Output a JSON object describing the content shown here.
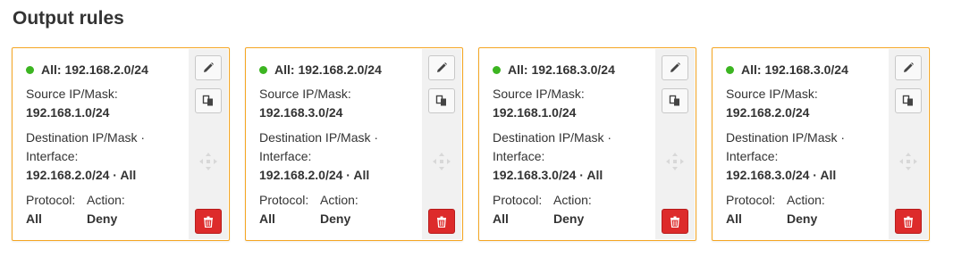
{
  "page": {
    "title": "Output rules"
  },
  "labels": {
    "source": "Source IP/Mask:",
    "destination_line1": "Destination IP/Mask ·",
    "destination_line2": "Interface:",
    "protocol": "Protocol:",
    "action": "Action:"
  },
  "colors": {
    "card_border": "#f5a623",
    "status_active": "#3cb521",
    "delete_button": "#dd2b2b"
  },
  "icons": [
    "pencil-icon",
    "copy-icon",
    "drag-move-icon",
    "trash-icon"
  ],
  "rules": [
    {
      "title": "All: 192.168.2.0/24",
      "source": "192.168.1.0/24",
      "destination": "192.168.2.0/24 · All",
      "protocol": "All",
      "action": "Deny"
    },
    {
      "title": "All: 192.168.2.0/24",
      "source": "192.168.3.0/24",
      "destination": "192.168.2.0/24 · All",
      "protocol": "All",
      "action": "Deny"
    },
    {
      "title": "All: 192.168.3.0/24",
      "source": "192.168.1.0/24",
      "destination": "192.168.3.0/24 · All",
      "protocol": "All",
      "action": "Deny"
    },
    {
      "title": "All: 192.168.3.0/24",
      "source": "192.168.2.0/24",
      "destination": "192.168.3.0/24 · All",
      "protocol": "All",
      "action": "Deny"
    }
  ]
}
